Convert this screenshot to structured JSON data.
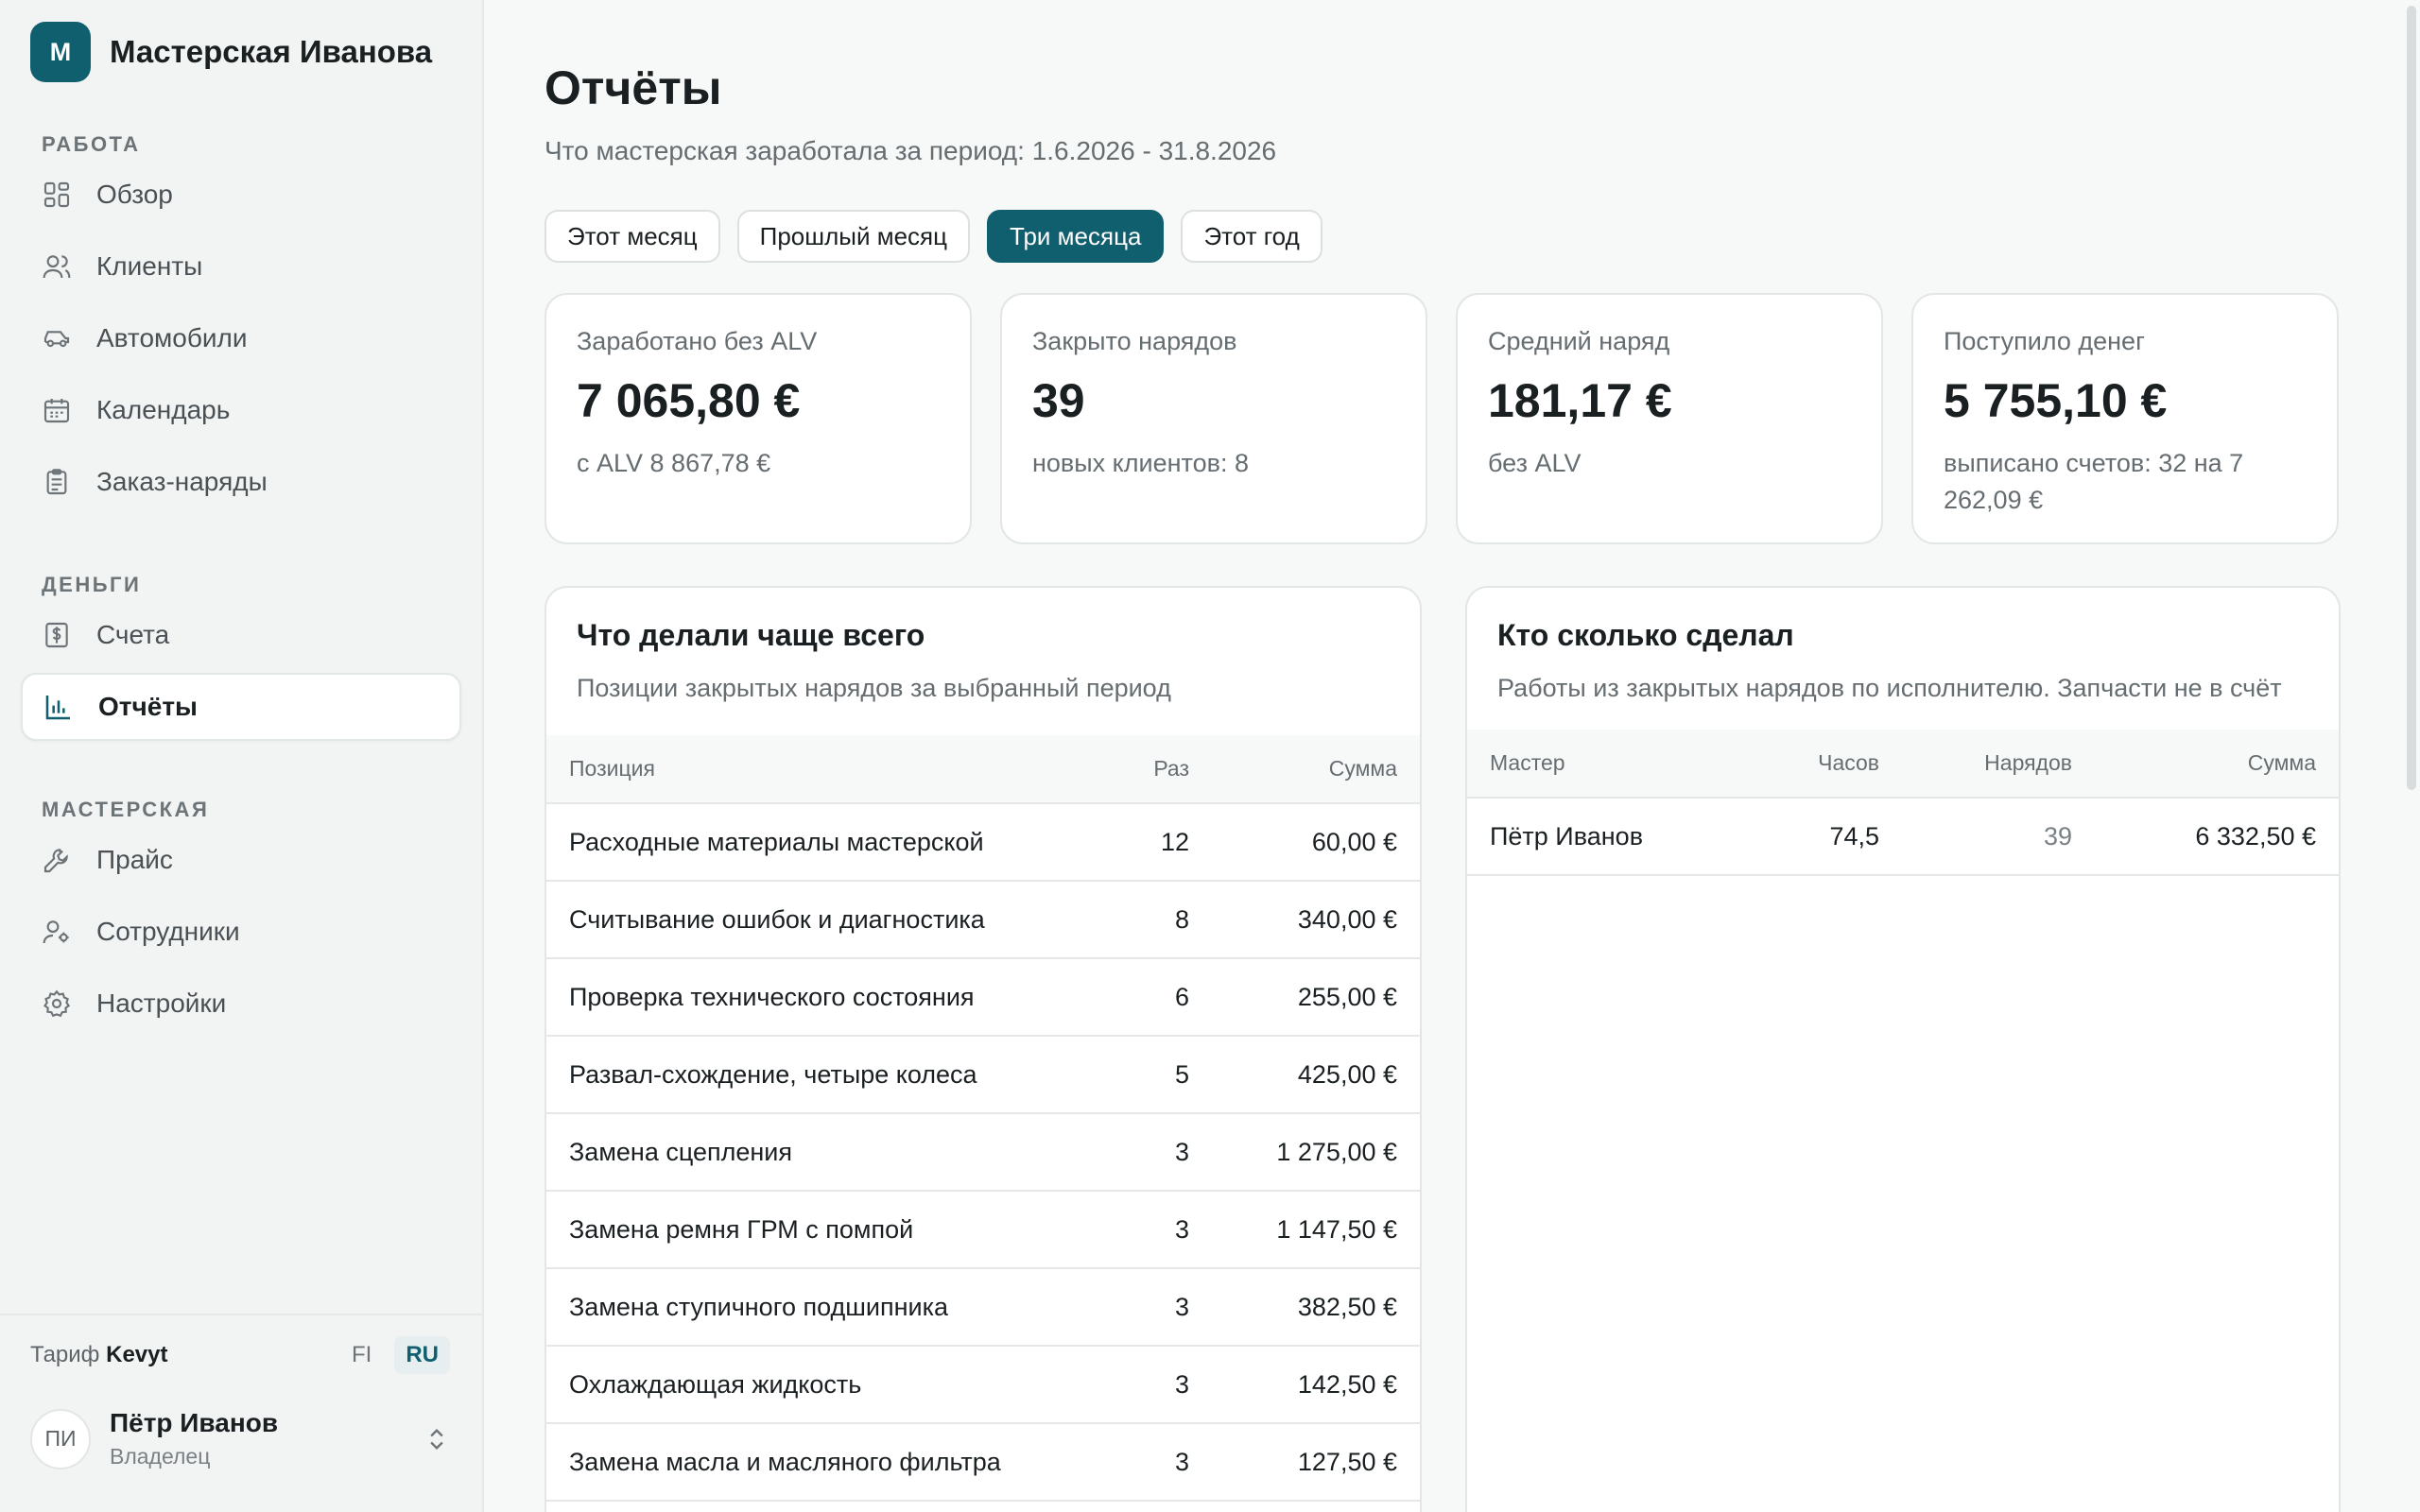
{
  "brand": {
    "logo_letter": "M",
    "name": "Мастерская Иванова"
  },
  "sidebar": {
    "sections": [
      {
        "label": "РАБОТА",
        "items": [
          {
            "label": "Обзор",
            "icon": "grid-icon"
          },
          {
            "label": "Клиенты",
            "icon": "users-icon"
          },
          {
            "label": "Автомобили",
            "icon": "car-icon"
          },
          {
            "label": "Календарь",
            "icon": "calendar-icon"
          },
          {
            "label": "Заказ-наряды",
            "icon": "clipboard-icon"
          }
        ]
      },
      {
        "label": "ДЕНЬГИ",
        "items": [
          {
            "label": "Счета",
            "icon": "invoice-icon"
          },
          {
            "label": "Отчёты",
            "icon": "bar-chart-icon",
            "active": true
          }
        ]
      },
      {
        "label": "МАСТЕРСКАЯ",
        "items": [
          {
            "label": "Прайс",
            "icon": "wrench-icon"
          },
          {
            "label": "Сотрудники",
            "icon": "staff-icon"
          },
          {
            "label": "Настройки",
            "icon": "gear-icon"
          }
        ]
      }
    ],
    "footer": {
      "plan_prefix": "Тариф",
      "plan_name": "Kevyt",
      "languages": [
        "FI",
        "RU"
      ],
      "active_language": "RU",
      "user": {
        "initials": "ПИ",
        "name": "Пётр Иванов",
        "role": "Владелец"
      }
    }
  },
  "page": {
    "title": "Отчёты",
    "subtitle": "Что мастерская заработала за период: 1.6.2026 - 31.8.2026",
    "filters": [
      {
        "label": "Этот месяц",
        "active": false
      },
      {
        "label": "Прошлый месяц",
        "active": false
      },
      {
        "label": "Три месяца",
        "active": true
      },
      {
        "label": "Этот год",
        "active": false
      }
    ]
  },
  "kpis": [
    {
      "label": "Заработано без ALV",
      "value": "7 065,80 €",
      "note": "с ALV 8 867,78 €"
    },
    {
      "label": "Закрыто нарядов",
      "value": "39",
      "note": "новых клиентов: 8"
    },
    {
      "label": "Средний наряд",
      "value": "181,17 €",
      "note": "без ALV"
    },
    {
      "label": "Поступило денег",
      "value": "5 755,10 €",
      "note": "выписано счетов: 32 на 7 262,09 €"
    }
  ],
  "top_items": {
    "title": "Что делали чаще всего",
    "subtitle": "Позиции закрытых нарядов за выбранный период",
    "columns": [
      "Позиция",
      "Раз",
      "Сумма"
    ],
    "rows": [
      {
        "name": "Расходные материалы мастерской",
        "count": "12",
        "sum": "60,00 €"
      },
      {
        "name": "Считывание ошибок и диагностика",
        "count": "8",
        "sum": "340,00 €"
      },
      {
        "name": "Проверка технического состояния",
        "count": "6",
        "sum": "255,00 €"
      },
      {
        "name": "Развал-схождение, четыре колеса",
        "count": "5",
        "sum": "425,00 €"
      },
      {
        "name": "Замена сцепления",
        "count": "3",
        "sum": "1 275,00 €"
      },
      {
        "name": "Замена ремня ГРМ с помпой",
        "count": "3",
        "sum": "1 147,50 €"
      },
      {
        "name": "Замена ступичного подшипника",
        "count": "3",
        "sum": "382,50 €"
      },
      {
        "name": "Охлаждающая жидкость",
        "count": "3",
        "sum": "142,50 €"
      },
      {
        "name": "Замена масла и масляного фильтра",
        "count": "3",
        "sum": "127,50 €"
      }
    ]
  },
  "by_master": {
    "title": "Кто сколько сделал",
    "subtitle": "Работы из закрытых нарядов по исполнителю. Запчасти не в счёт",
    "columns": [
      "Мастер",
      "Часов",
      "Нарядов",
      "Сумма"
    ],
    "rows": [
      {
        "name": "Пётр Иванов",
        "hours": "74,5",
        "orders": "39",
        "sum": "6 332,50 €"
      }
    ]
  }
}
